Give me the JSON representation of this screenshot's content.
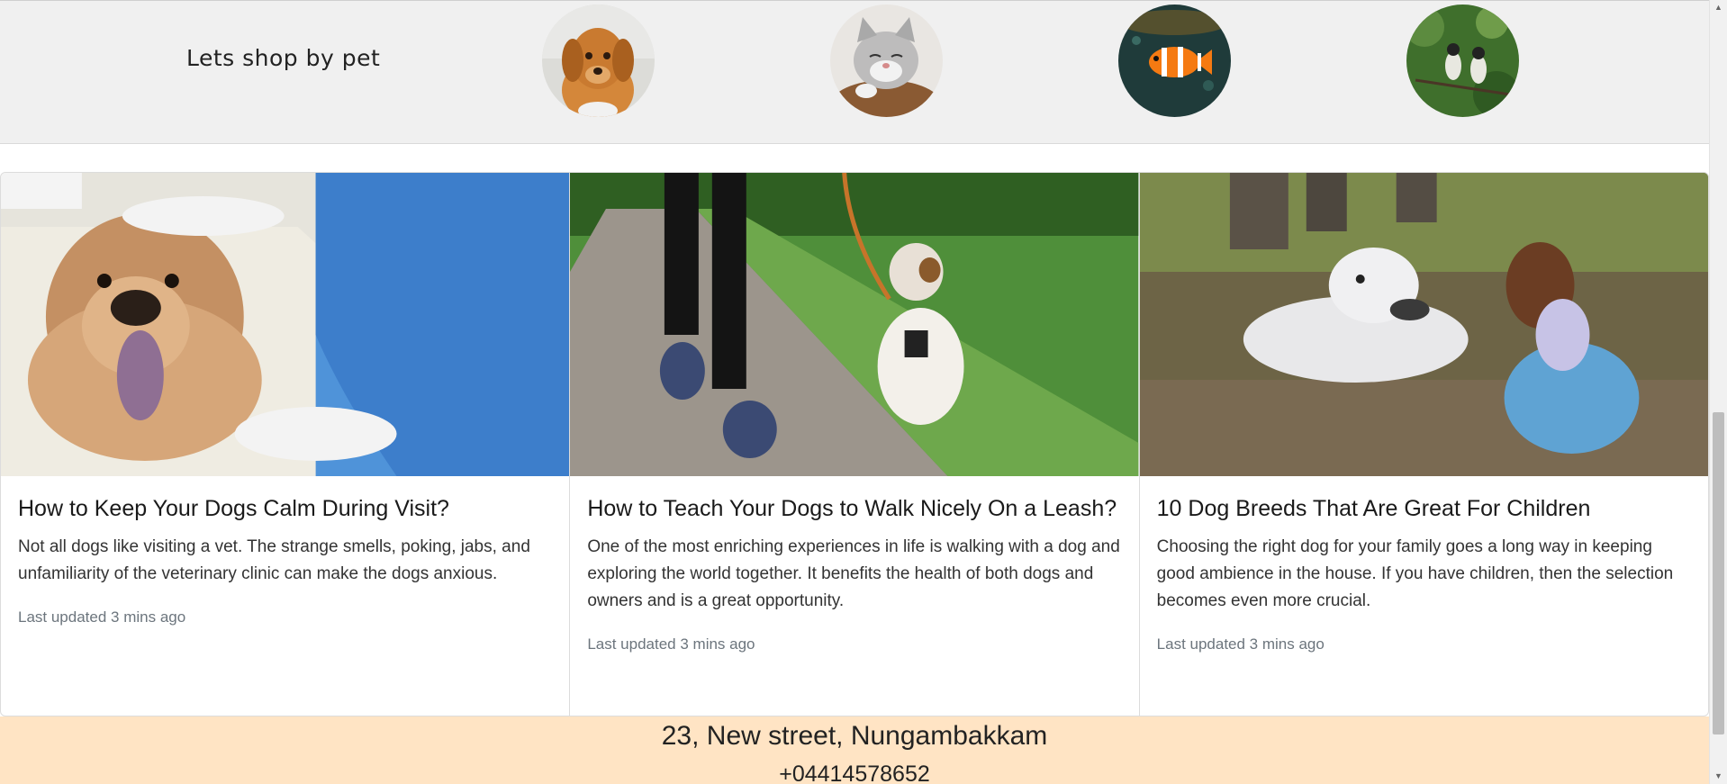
{
  "shop": {
    "title": "Lets shop by pet",
    "pets": [
      "dog-icon",
      "cat-icon",
      "fish-icon",
      "bird-icon"
    ]
  },
  "cards": [
    {
      "title": "How to Keep Your Dogs Calm During Visit?",
      "text": "Not all dogs like visiting a vet. The strange smells, poking, jabs, and unfamiliarity of the veterinary clinic can make the dogs anxious.",
      "updated": "Last updated 3 mins ago"
    },
    {
      "title": "How to Teach Your Dogs to Walk Nicely On a Leash?",
      "text": "One of the most enriching experiences in life is walking with a dog and exploring the world together. It benefits the health of both dogs and owners and is a great opportunity.",
      "updated": "Last updated 3 mins ago"
    },
    {
      "title": "10 Dog Breeds That Are Great For Children",
      "text": "Choosing the right dog for your family goes a long way in keeping good ambience in the house. If you have children, then the selection becomes even more crucial.",
      "updated": "Last updated 3 mins ago"
    }
  ],
  "footer": {
    "address": "23, New street, Nungambakkam",
    "phone": "+04414578652"
  },
  "colors": {
    "strip_bg": "#f0f0f0",
    "footer_bg": "#ffe4c4",
    "muted_text": "#6c757d"
  }
}
